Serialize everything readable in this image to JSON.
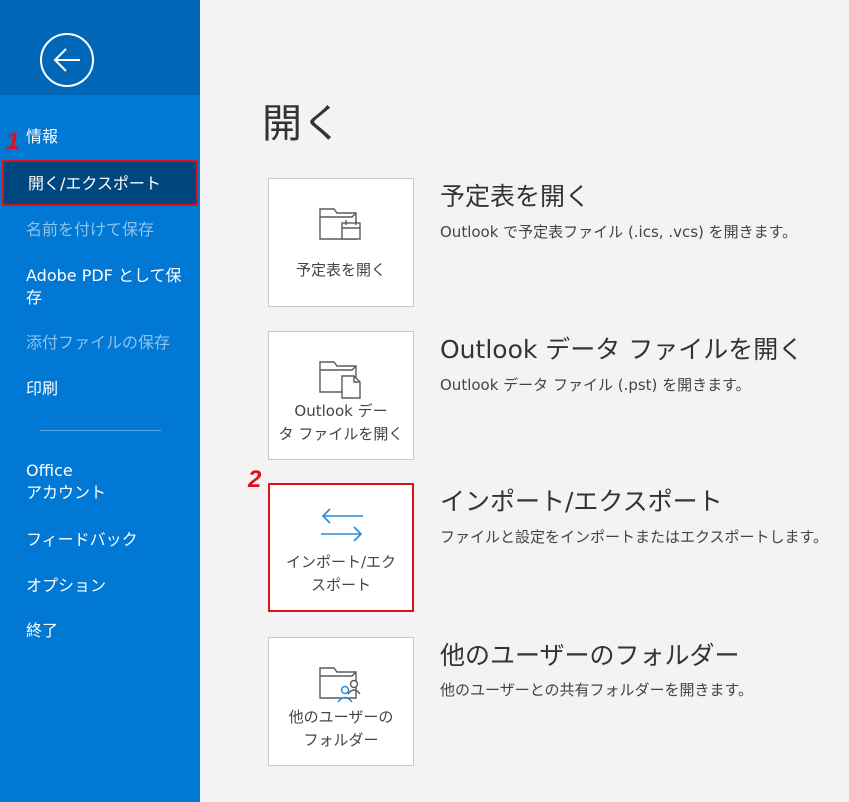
{
  "sidebar": {
    "items": [
      {
        "label": "情報"
      },
      {
        "label": "開く/エクスポート"
      },
      {
        "label": "名前を付けて保存"
      },
      {
        "label_line1": "Adobe PDF として保",
        "label_line2": "存"
      },
      {
        "label": "添付ファイルの保存"
      },
      {
        "label": "印刷"
      },
      {
        "label_line1": "Office",
        "label_line2": "アカウント"
      },
      {
        "label": "フィードバック"
      },
      {
        "label": "オプション"
      },
      {
        "label": "終了"
      }
    ]
  },
  "annotations": {
    "step1": "1",
    "step2": "2"
  },
  "main": {
    "title": "開く",
    "options": [
      {
        "tile_line1": "予定表を開く",
        "tile_line2": "",
        "title": "予定表を開く",
        "description": "Outlook で予定表ファイル (.ics, .vcs) を開きます。"
      },
      {
        "tile_line1": "Outlook デー",
        "tile_line2": "タ ファイルを開く",
        "title": "Outlook データ ファイルを開く",
        "description": "Outlook データ ファイル (.pst) を開きます。"
      },
      {
        "tile_line1": "インポート/エク",
        "tile_line2": "スポート",
        "title": "インポート/エクスポート",
        "description": "ファイルと設定をインポートまたはエクスポートします。"
      },
      {
        "tile_line1": "他のユーザーの",
        "tile_line2": "フォルダー",
        "title": "他のユーザーのフォルダー",
        "description": "他のユーザーとの共有フォルダーを開きます。"
      }
    ]
  },
  "colors": {
    "sidebar": "#0078d4",
    "sidebar_selected": "#00467f",
    "highlight": "#e0101a",
    "icon_accent": "#2b88d8"
  },
  "icons": [
    "back-arrow-icon",
    "calendar-folder-icon",
    "data-file-folder-icon",
    "import-export-icon",
    "shared-folder-icon"
  ]
}
